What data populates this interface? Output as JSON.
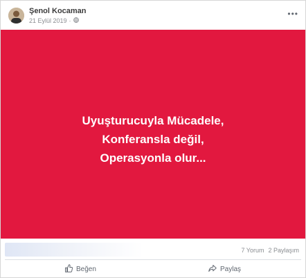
{
  "post": {
    "author": "Şenol Kocaman",
    "date": "21 Eylül 2019",
    "separator": "·",
    "image_lines": [
      "Uyuşturucuyla Mücadele,",
      "Konferansla değil,",
      "Operasyonla olur..."
    ],
    "comments_count": "7 Yorum",
    "shares_count": "2 Paylaşım"
  },
  "actions": {
    "like_label": "Beğen",
    "share_label": "Paylaş"
  },
  "colors": {
    "image_background": "#e2183f",
    "text_on_image": "#ffffff"
  },
  "icons": [
    "avatar",
    "globe-icon",
    "more-icon",
    "like-icon",
    "share-icon"
  ]
}
